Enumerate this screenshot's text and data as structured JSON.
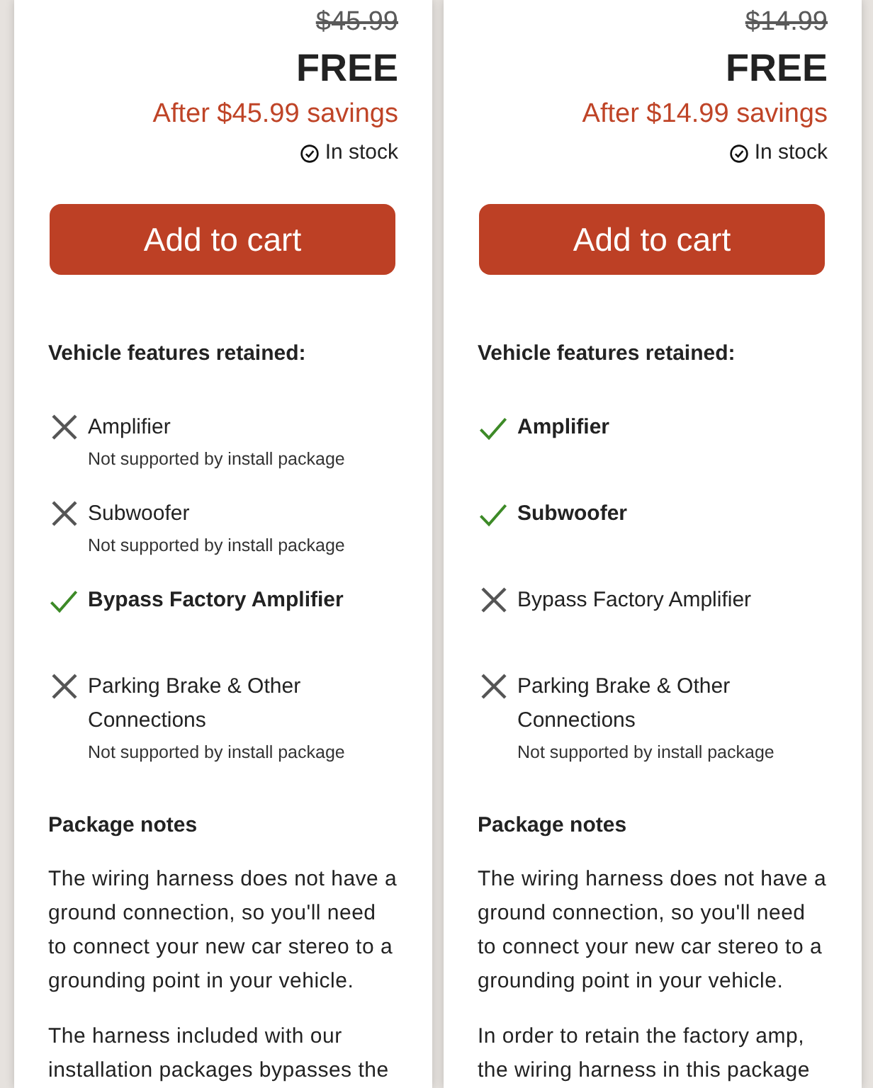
{
  "cards": [
    {
      "original_price": "$45.99",
      "price": "FREE",
      "savings": "After $45.99 savings",
      "stock": "In stock",
      "button": "Add to cart",
      "features_heading": "Vehicle features retained:",
      "features": [
        {
          "name": "Amplifier",
          "retained": false,
          "note": "Not supported by install package"
        },
        {
          "name": "Subwoofer",
          "retained": false,
          "note": "Not supported by install package"
        },
        {
          "name": "Bypass Factory Amplifier",
          "retained": true
        },
        {
          "name": "Parking Brake & Other Connections",
          "retained": false,
          "note": "Not supported by install package"
        }
      ],
      "notes_heading": "Package notes",
      "notes": [
        "The wiring harness does not have a ground connection, so you'll need to connect your new car stereo to a grounding point in your vehicle.",
        "The harness included with our installation packages bypasses the"
      ]
    },
    {
      "original_price": "$14.99",
      "price": "FREE",
      "savings": "After $14.99 savings",
      "stock": "In stock",
      "button": "Add to cart",
      "features_heading": "Vehicle features retained:",
      "features": [
        {
          "name": "Amplifier",
          "retained": true
        },
        {
          "name": "Subwoofer",
          "retained": true
        },
        {
          "name": "Bypass Factory Amplifier",
          "retained": false
        },
        {
          "name": "Parking Brake & Other Connections",
          "retained": false,
          "note": "Not supported by install package"
        }
      ],
      "notes_heading": "Package notes",
      "notes": [
        "The wiring harness does not have a ground connection, so you'll need to connect your new car stereo to a grounding point in your vehicle.",
        "In order to retain the factory amp, the wiring harness in this package"
      ]
    }
  ]
}
